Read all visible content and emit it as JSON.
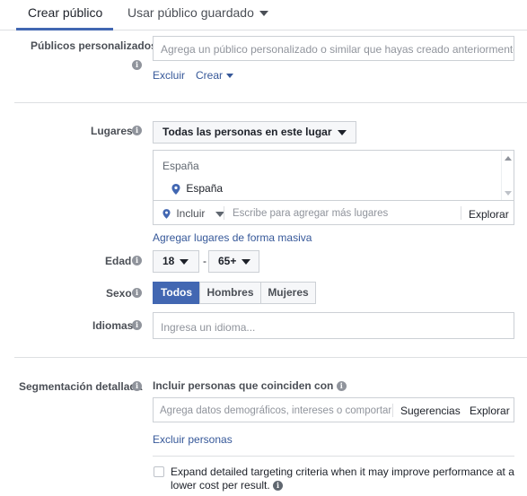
{
  "tabs": {
    "create_audience": "Crear público",
    "saved_audience": "Usar público guardado"
  },
  "custom_audiences": {
    "label": "Públicos personalizados",
    "placeholder": "Agrega un público personalizado o similar que hayas creado anteriormente",
    "exclude_link": "Excluir",
    "create_link": "Crear"
  },
  "locations": {
    "label": "Lugares",
    "dropdown_value": "Todas las personas en este lugar",
    "group_header": "España",
    "selected_item": "España",
    "include_value": "Incluir",
    "search_placeholder": "Escribe para agregar más lugares",
    "browse_button": "Explorar",
    "bulk_link": "Agregar lugares de forma masiva"
  },
  "age": {
    "label": "Edad",
    "min_value": "18",
    "separator": "-",
    "max_value": "65+"
  },
  "gender": {
    "label": "Sexo",
    "options": [
      "Todos",
      "Hombres",
      "Mujeres"
    ]
  },
  "languages": {
    "label": "Idiomas",
    "placeholder": "Ingresa un idioma..."
  },
  "detailed_targeting": {
    "label": "Segmentación detallada",
    "include_text": "Incluir personas que coinciden con",
    "placeholder": "Agrega datos demográficos, intereses o comportamie",
    "suggestions_button": "Sugerencias",
    "browse_button": "Explorar",
    "exclude_link": "Excluir personas",
    "expand_text": "Expand detailed targeting criteria when it may improve performance at a lower cost per result."
  },
  "colors": {
    "accent": "#4267b2",
    "link": "#365899",
    "border": "#ccd0d5"
  }
}
